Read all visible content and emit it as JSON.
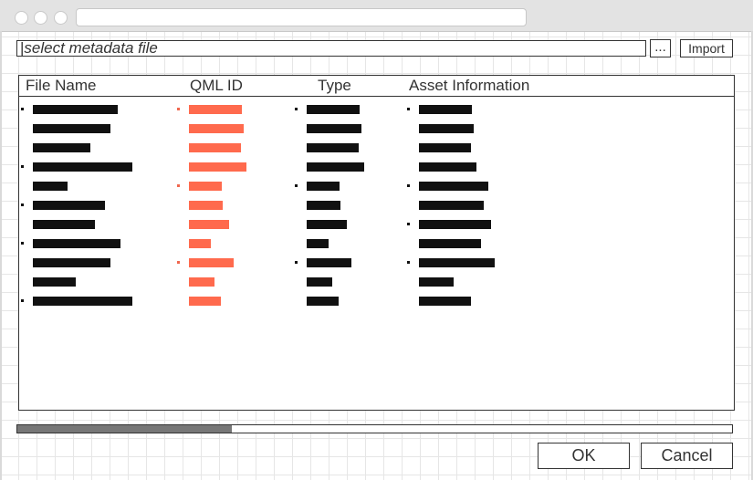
{
  "window": {
    "url": ""
  },
  "file_picker": {
    "placeholder": "select metadata file",
    "browse_label": "...",
    "import_label": "Import"
  },
  "table": {
    "columns": [
      "File Name",
      "QML ID",
      "Type",
      "Asset Information"
    ]
  },
  "progress": {
    "fraction": 0.3
  },
  "footer": {
    "ok_label": "OK",
    "cancel_label": "Cancel"
  },
  "colors": {
    "accent": "#ff6a4d",
    "redacted": "#111111",
    "progress_fill": "#777777"
  }
}
